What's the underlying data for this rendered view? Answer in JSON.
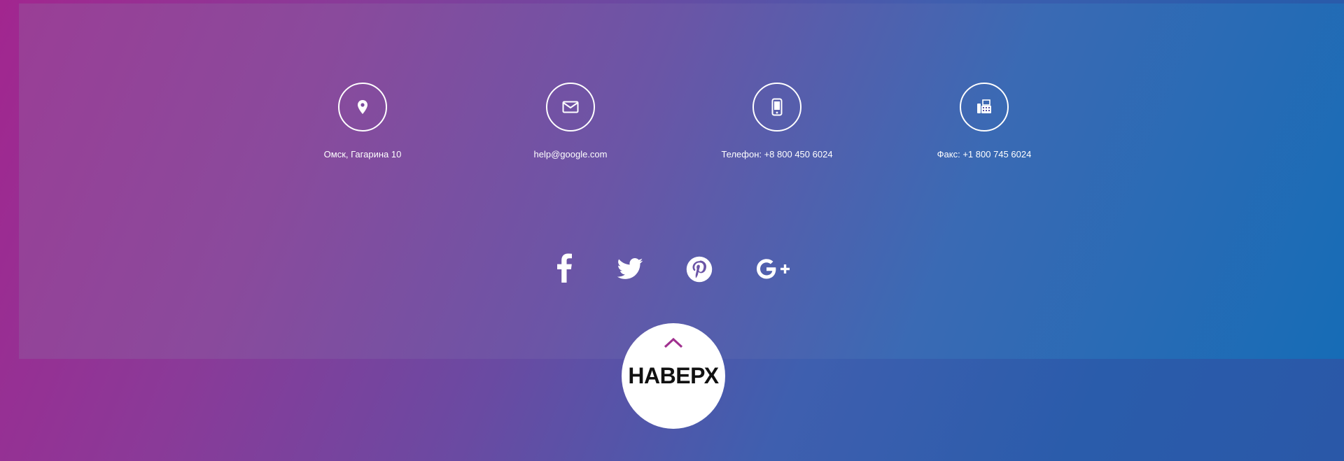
{
  "contacts": [
    {
      "icon": "map-pin-icon",
      "label": "Омск, Гагарина 10"
    },
    {
      "icon": "envelope-icon",
      "label": "help@google.com"
    },
    {
      "icon": "mobile-phone-icon",
      "label": "Телефон: +8 800 450 6024"
    },
    {
      "icon": "fax-icon",
      "label": "Факс: +1 800 745 6024"
    }
  ],
  "socials": [
    {
      "icon": "facebook-icon"
    },
    {
      "icon": "twitter-icon"
    },
    {
      "icon": "pinterest-icon"
    },
    {
      "icon": "google-plus-icon"
    }
  ],
  "back_to_top": {
    "label": "НАВЕРХ",
    "icon": "chevron-up-icon",
    "accent": "#a0308f"
  },
  "colors": {
    "text": "#ffffff",
    "button_bg": "#ffffff",
    "button_text": "#111111"
  }
}
